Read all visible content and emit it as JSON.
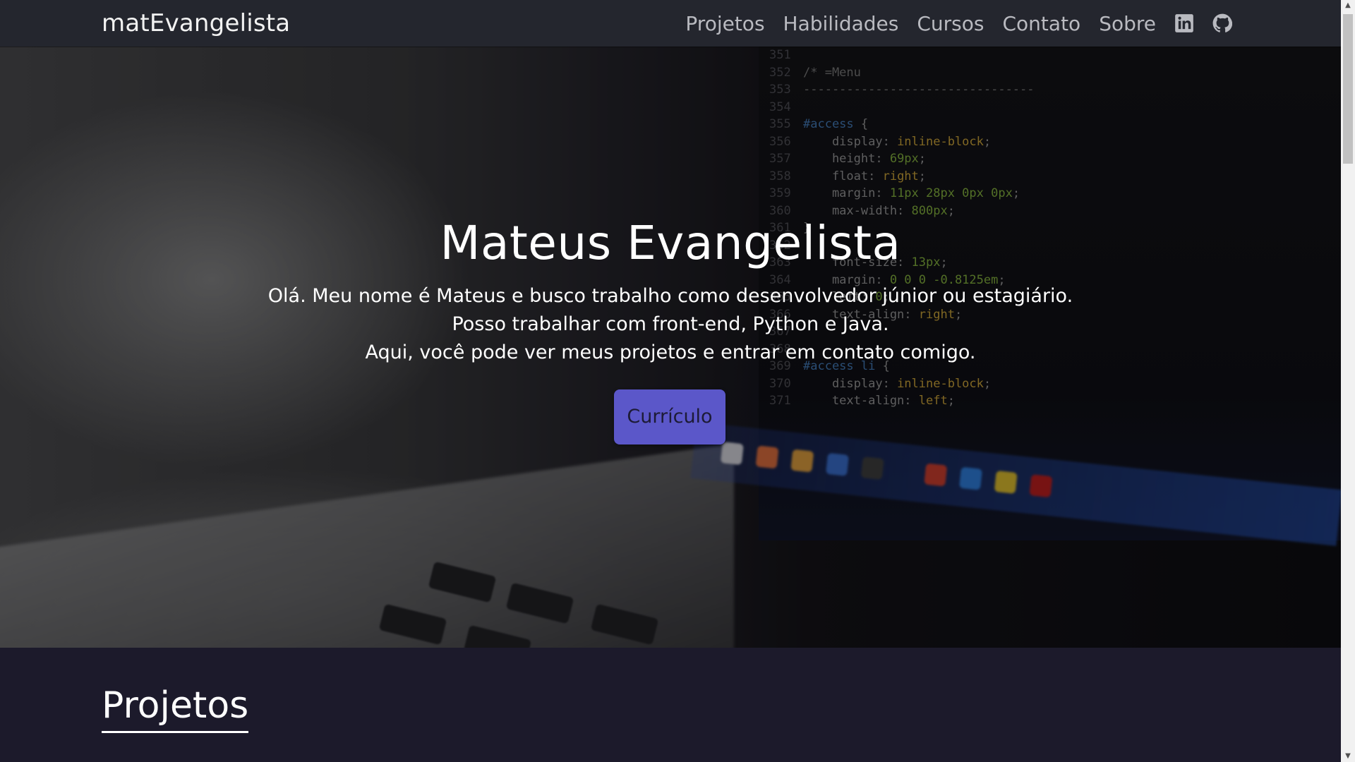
{
  "navbar": {
    "brand": "matEvangelista",
    "links": [
      "Projetos",
      "Habilidades",
      "Cursos",
      "Contato",
      "Sobre"
    ],
    "icons": [
      "linkedin-icon",
      "github-icon"
    ]
  },
  "hero": {
    "title": "Mateus Evangelista",
    "lines": [
      "Olá. Meu nome é Mateus e busco trabalho como desenvolvedor júnior ou estagiário.",
      "Posso trabalhar com front-end, Python e Java.",
      "Aqui, você pode ver meus projetos e entrar em contato comigo."
    ],
    "button_label": "Currículo"
  },
  "projects": {
    "title": "Projetos"
  },
  "colors": {
    "accent": "#5b57c9",
    "navbar_bg": "#24262e",
    "section_bg": "#1c1a2b"
  }
}
